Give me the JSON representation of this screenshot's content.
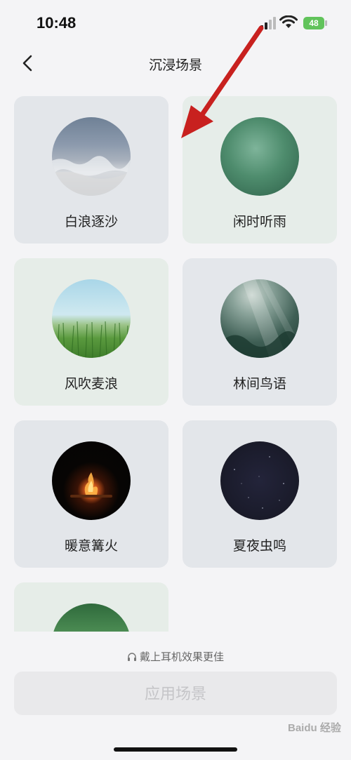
{
  "status_bar": {
    "time": "10:48",
    "battery": "48"
  },
  "nav": {
    "title": "沉浸场景"
  },
  "scenes": [
    {
      "label": "白浪逐沙",
      "image": "sandy-beach-waves"
    },
    {
      "label": "闲时听雨",
      "image": "green-rain"
    },
    {
      "label": "风吹麦浪",
      "image": "wheat-field-sky"
    },
    {
      "label": "林间鸟语",
      "image": "forest-sunbeams"
    },
    {
      "label": "暖意篝火",
      "image": "campfire-night"
    },
    {
      "label": "夏夜虫鸣",
      "image": "starry-night"
    },
    {
      "label": "",
      "image": "jungle-plants"
    }
  ],
  "footer": {
    "hint": "戴上耳机效果更佳",
    "apply_label": "应用场景"
  },
  "watermark": {
    "text": "Baidu 经验"
  },
  "colors": {
    "annotation_arrow": "#c8211f",
    "battery": "#61c35b",
    "apply_disabled_text": "#c5c5c8"
  }
}
